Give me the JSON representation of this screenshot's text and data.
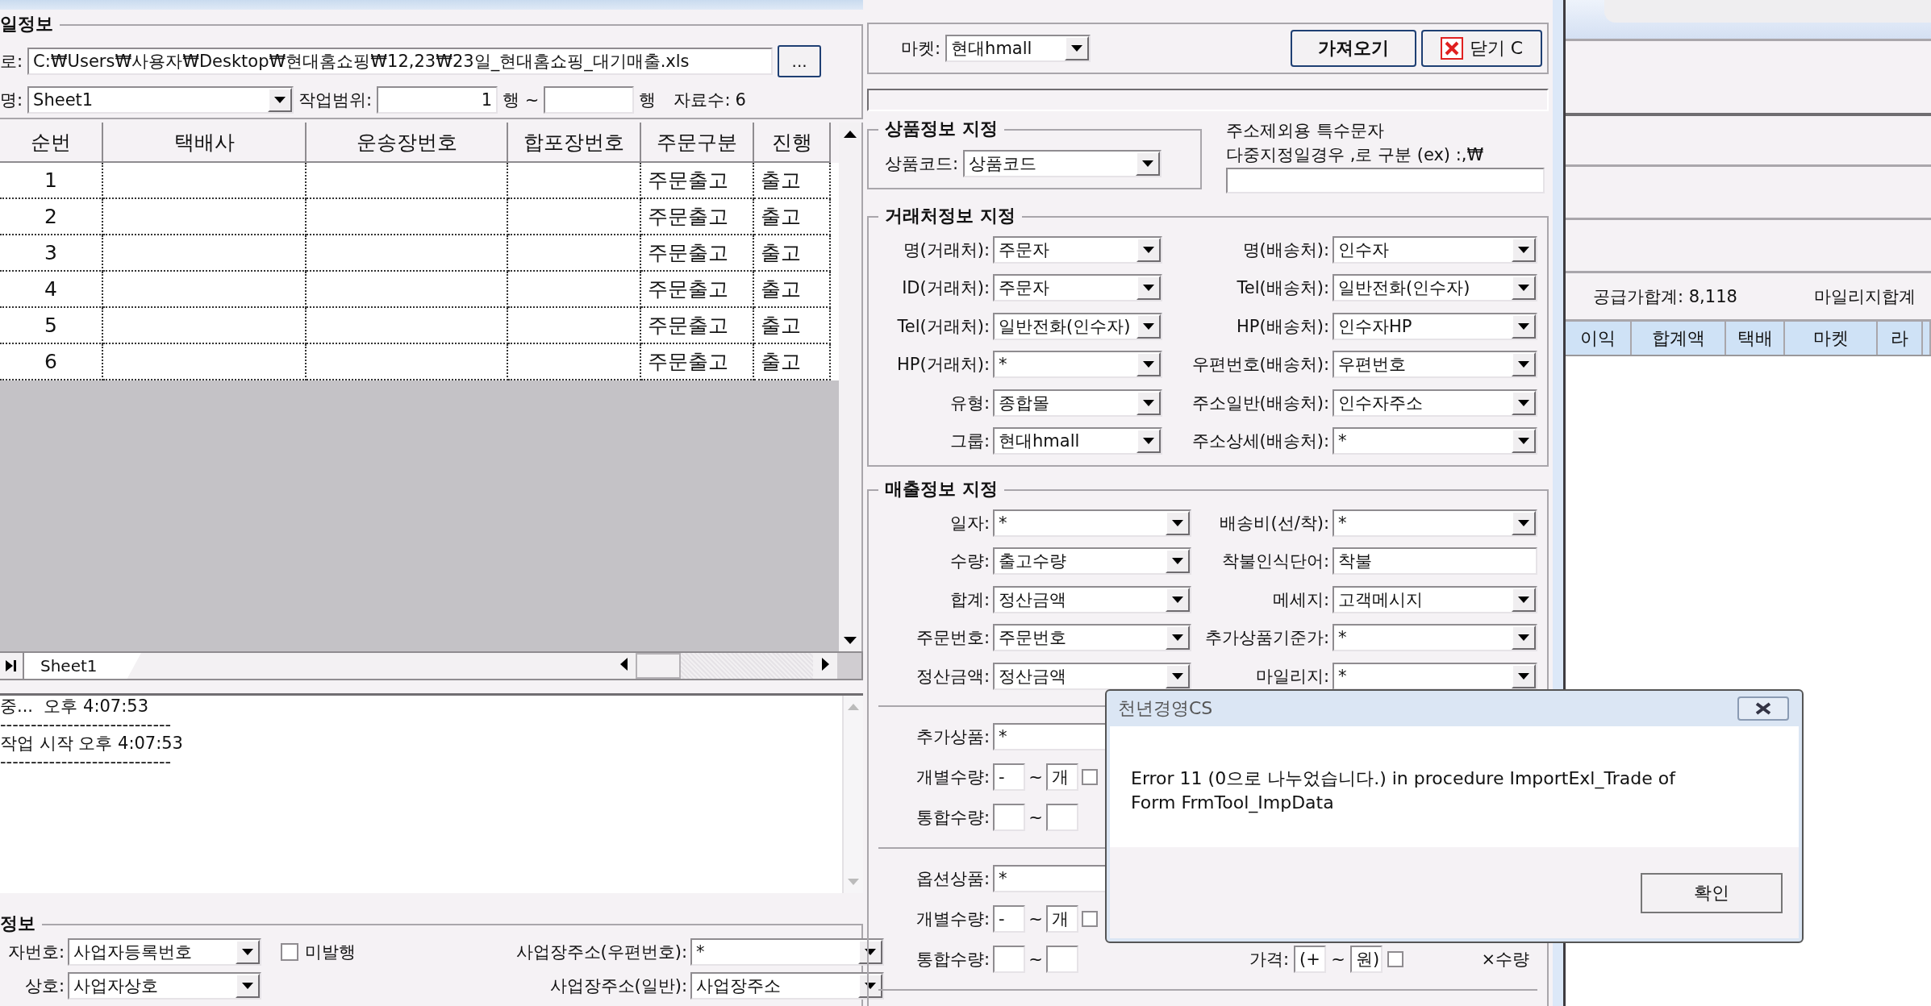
{
  "file_info": {
    "title": "일정보",
    "path_label": "로:",
    "path": "C:₩Users₩사용자₩Desktop₩현대홈쇼핑₩12,23₩23일_현대홈쇼핑_대기매출.xls",
    "browse": "...",
    "sheet_label": "명:",
    "sheet": "Sheet1",
    "range_label": "작업범위:",
    "range_from": "1",
    "range_sep": "행 ~",
    "range_unit": "행",
    "count_label": "자료수:",
    "count": "6"
  },
  "grid": {
    "columns": [
      "순번",
      "택배사",
      "운송장번호",
      "합포장번호",
      "주문구분",
      "진행"
    ],
    "rows": [
      {
        "no": "1",
        "order_type": "주문출고",
        "status": "출고"
      },
      {
        "no": "2",
        "order_type": "주문출고",
        "status": "출고"
      },
      {
        "no": "3",
        "order_type": "주문출고",
        "status": "출고"
      },
      {
        "no": "4",
        "order_type": "주문출고",
        "status": "출고"
      },
      {
        "no": "5",
        "order_type": "주문출고",
        "status": "출고"
      },
      {
        "no": "6",
        "order_type": "주문출고",
        "status": "출고"
      }
    ]
  },
  "sheet_tabs": [
    {
      "label": "Sheet1",
      "selected": true
    }
  ],
  "log": [
    "중...  오후 4:07:53",
    "----------------------------",
    "작업 시작 오후 4:07:53",
    "----------------------------"
  ],
  "business_group": {
    "title": "정보",
    "rows": [
      {
        "left": {
          "kind": "combo",
          "label": "자번호:",
          "value": "사업자등록번호"
        },
        "check": {
          "label": "미발행",
          "checked": false
        },
        "right": {
          "kind": "combo",
          "label": "사업장주소(우편번호):",
          "value": "*"
        }
      },
      {
        "left": {
          "kind": "combo",
          "label": "상호:",
          "value": "사업자상호"
        },
        "right": {
          "kind": "combo",
          "label": "사업장주소(일반):",
          "value": "사업장주소"
        }
      }
    ]
  },
  "market": {
    "label": "마켓:",
    "value": "현대hmall"
  },
  "actions": [
    {
      "kind": "import",
      "label": "가져오기"
    },
    {
      "kind": "close",
      "label": "닫기 C"
    }
  ],
  "progress": {
    "level": 0
  },
  "product_group": {
    "title": "상품정보 지정",
    "label": "상품코드:",
    "value": "상품코드"
  },
  "exclude_chars": {
    "title": "주소제외용 특수문자",
    "hint": "다중지정일경우 ,로 구분 (ex) :,₩"
  },
  "client_group": {
    "title": "거래처정보 지정",
    "rows": [
      {
        "left": {
          "kind": "combo",
          "label": "명(거래처):",
          "value": "주문자"
        },
        "right": {
          "kind": "combo",
          "label": "명(배송처):",
          "value": "인수자"
        }
      },
      {
        "left": {
          "kind": "combo",
          "label": "ID(거래처):",
          "value": "주문자"
        },
        "right": {
          "kind": "combo",
          "label": "Tel(배송처):",
          "value": "일반전화(인수자)"
        }
      },
      {
        "left": {
          "kind": "combo",
          "label": "Tel(거래처):",
          "value": "일반전화(인수자)"
        },
        "right": {
          "kind": "combo",
          "label": "HP(배송처):",
          "value": "인수자HP"
        }
      },
      {
        "left": {
          "kind": "combo",
          "label": "HP(거래처):",
          "value": "*"
        },
        "right": {
          "kind": "combo",
          "label": "우편번호(배송처):",
          "value": "우편번호"
        }
      },
      {
        "left": {
          "kind": "combo",
          "label": "유형:",
          "value": "종합몰"
        },
        "right": {
          "kind": "combo",
          "label": "주소일반(배송처):",
          "value": "인수자주소"
        }
      },
      {
        "left": {
          "kind": "combo",
          "label": "그룹:",
          "value": "현대hmall"
        },
        "right": {
          "kind": "combo",
          "label": "주소상세(배송처):",
          "value": "*"
        }
      }
    ]
  },
  "sales_group": {
    "title": "매출정보 지정",
    "rows": [
      {
        "left": {
          "kind": "combo",
          "label": "일자:",
          "value": "*"
        },
        "right": {
          "kind": "combo",
          "label": "배송비(선/착):",
          "value": "*"
        }
      },
      {
        "left": {
          "kind": "combo",
          "label": "수량:",
          "value": "출고수량"
        },
        "right": {
          "kind": "text",
          "label": "착불인식단어:",
          "value": "착불"
        }
      },
      {
        "left": {
          "kind": "combo",
          "label": "합계:",
          "value": "정산금액"
        },
        "right": {
          "kind": "combo",
          "label": "메세지:",
          "value": "고객메시지"
        }
      },
      {
        "left": {
          "kind": "combo",
          "label": "주문번호:",
          "value": "주문번호"
        },
        "right": {
          "kind": "combo",
          "label": "추가상품기준가:",
          "value": "*"
        }
      },
      {
        "left": {
          "kind": "combo",
          "label": "정산금액:",
          "value": "정산금액"
        },
        "right": {
          "kind": "combo",
          "label": "마일리지:",
          "value": "*"
        }
      }
    ]
  },
  "extra_product": {
    "label": "추가상품:",
    "value": "*",
    "qty_label": "개별수량:",
    "qty_from": "-",
    "qty_sep": "~",
    "qty_to": "개",
    "qty_checked": false,
    "total_label": "통합수량:",
    "total_sep": "~"
  },
  "option_product": {
    "label": "옵션상품:",
    "value": "*",
    "qty_label": "개별수량:",
    "qty_from": "-",
    "qty_sep": "~",
    "qty_to": "개",
    "qty_checked": false,
    "total_label": "통합수량:",
    "total_sep": "~",
    "price_label": "가격:",
    "price_from": "(+",
    "price_sep": "~",
    "price_to": "원)",
    "price_checked": false,
    "price_check_label": "×수량"
  },
  "summary": {
    "supply_total": "공급가합계: 8,118",
    "mileage_total": "마일리지합계"
  },
  "result_grid": {
    "columns": [
      "이익",
      "합계액",
      "택배",
      "마켓",
      "라"
    ]
  },
  "dialog": {
    "title": "천년경영CS",
    "message": "Error 11 (0으로 나누었습니다.) in procedure ImportExl_Trade of Form FrmTool_ImpData",
    "ok": "확인"
  }
}
